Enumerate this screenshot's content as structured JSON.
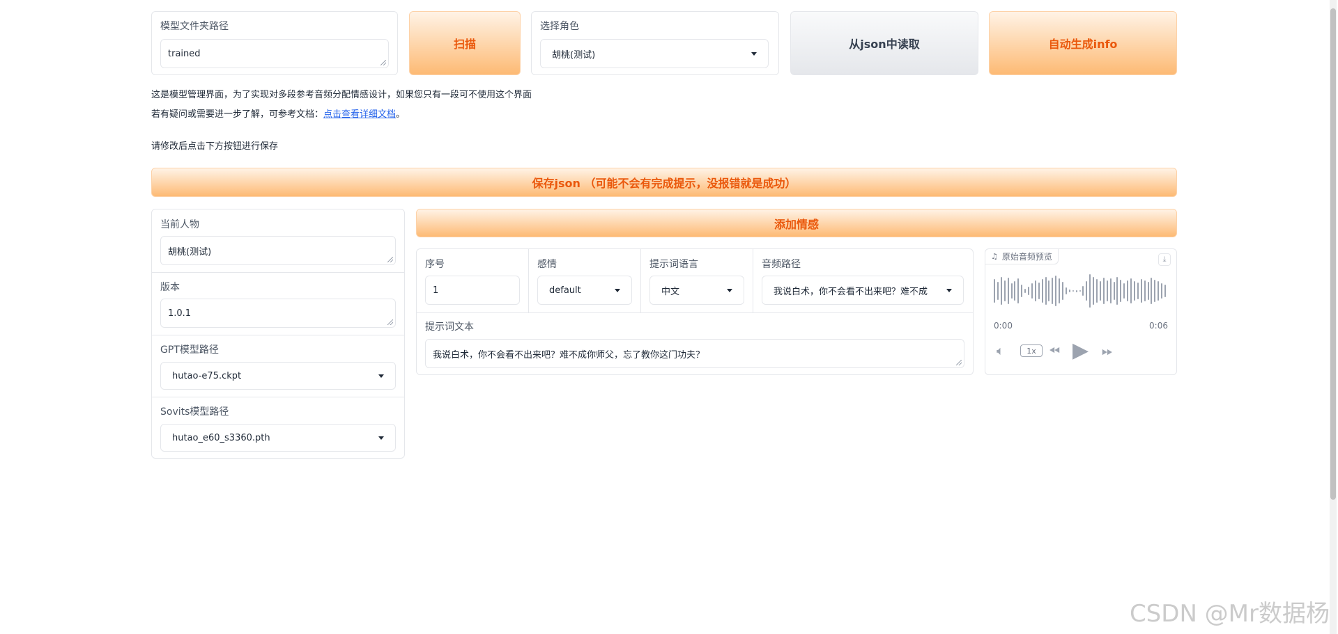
{
  "top": {
    "model_folder": {
      "label": "模型文件夹路径",
      "value": "trained"
    },
    "scan_button": "扫描",
    "role": {
      "label": "选择角色",
      "value": "胡桃(测试)"
    },
    "read_json_button": "从json中读取",
    "auto_info_button": "自动生成info"
  },
  "info": {
    "line1": "这是模型管理界面，为了实现对多段参考音频分配情感设计，如果您只有一段可不使用这个界面",
    "line2_prefix": "若有疑问或需要进一步了解，可参考文档：",
    "line2_link": "点击查看详细文档",
    "line2_suffix": "。",
    "line3": "请修改后点击下方按钮进行保存"
  },
  "save_json_button": "保存json （可能不会有完成提示，没报错就是成功）",
  "left_panel": {
    "current_char": {
      "label": "当前人物",
      "value": "胡桃(测试)"
    },
    "version": {
      "label": "版本",
      "value": "1.0.1"
    },
    "gpt_path": {
      "label": "GPT模型路径",
      "value": "hutao-e75.ckpt"
    },
    "sovits_path": {
      "label": "Sovits模型路径",
      "value": "hutao_e60_s3360.pth"
    }
  },
  "add_emotion_button": "添加情感",
  "emotion": {
    "index": {
      "label": "序号",
      "value": "1"
    },
    "emotion": {
      "label": "感情",
      "value": "default"
    },
    "prompt_lang": {
      "label": "提示词语言",
      "value": "中文"
    },
    "audio_path": {
      "label": "音频路径",
      "value": "我说白术，你不会看不出来吧？难不成"
    },
    "prompt_text": {
      "label": "提示词文本",
      "value": "我说白术，你不会看不出来吧？难不成你师父，忘了教你这门功夫？"
    }
  },
  "audio": {
    "label": "原始音频预览",
    "time_start": "0:00",
    "time_end": "0:06",
    "speed": "1x"
  },
  "watermark": "CSDN @Mr数据杨",
  "icons": [
    "music-note-icon",
    "download-icon",
    "volume-icon",
    "rewind-icon",
    "play-icon",
    "fast-forward-icon",
    "chevron-down-icon"
  ]
}
